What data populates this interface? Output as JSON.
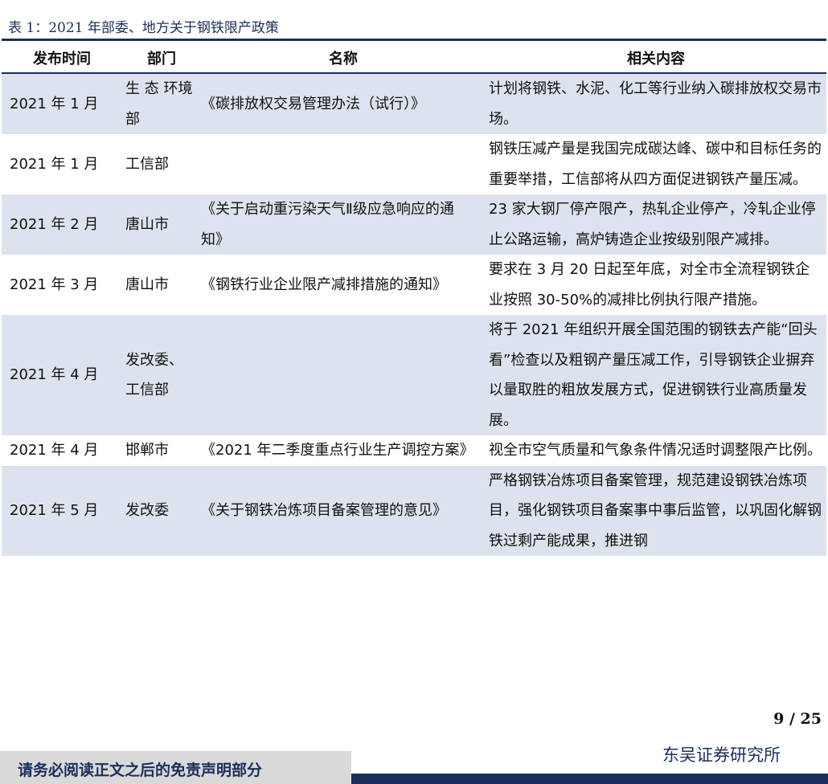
{
  "caption": "表 1：2021 年部委、地方关于钢铁限产政策",
  "columns": [
    "发布时间",
    "部门",
    "名称",
    "相关内容"
  ],
  "rows": [
    {
      "time": "2021 年 1 月",
      "dept": "生 态 环境部",
      "name": "《碳排放权交易管理办法（试行）》",
      "content": "计划将钢铁、水泥、化工等行业纳入碳排放权交易市场。"
    },
    {
      "time": "2021 年 1 月",
      "dept": "工信部",
      "name": "",
      "content": "钢铁压减产量是我国完成碳达峰、碳中和目标任务的重要举措，工信部将从四方面促进钢铁产量压减。"
    },
    {
      "time": "2021 年 2 月",
      "dept": "唐山市",
      "name": "《关于启动重污染天气Ⅱ级应急响应的通知》",
      "content": "23 家大钢厂停产限产，热轧企业停产，冷轧企业停止公路运输，高炉铸造企业按级别限产减排。"
    },
    {
      "time": "2021 年 3 月",
      "dept": "唐山市",
      "name": "《钢铁行业企业限产减排措施的通知》",
      "content": "要求在 3 月 20 日起至年底，对全市全流程钢铁企业按照 30-50%的减排比例执行限产措施。"
    },
    {
      "time": "2021 年 4 月",
      "dept": "发改委、工信部",
      "name": "",
      "content": "将于 2021 年组织开展全国范围的钢铁去产能“回头看”检查以及粗钢产量压减工作，引导钢铁企业摒弃以量取胜的粗放发展方式，促进钢铁行业高质量发展。"
    },
    {
      "time": "2021 年 4 月",
      "dept": "邯郸市",
      "name": "《2021 年二季度重点行业生产调控方案》",
      "content": "视全市空气质量和气象条件情况适时调整限产比例。"
    },
    {
      "time": "2021 年 5 月",
      "dept": "发改委",
      "name": "《关于钢铁冶炼项目备案管理的意见》",
      "content": "严格钢铁冶炼项目备案管理，规范建设钢铁冶炼项目，强化钢铁项目备案事中事后监管，以巩固化解钢铁过剩产能成果，推进钢"
    }
  ],
  "page_number": "9 / 25",
  "firm": "东吴证券研究所",
  "disclaimer": "请务必阅读正文之后的免责声明部分",
  "colors": {
    "navy": "#1b2f5b",
    "band": "#dde3ee",
    "footer_gray": "#d9d9d9"
  }
}
